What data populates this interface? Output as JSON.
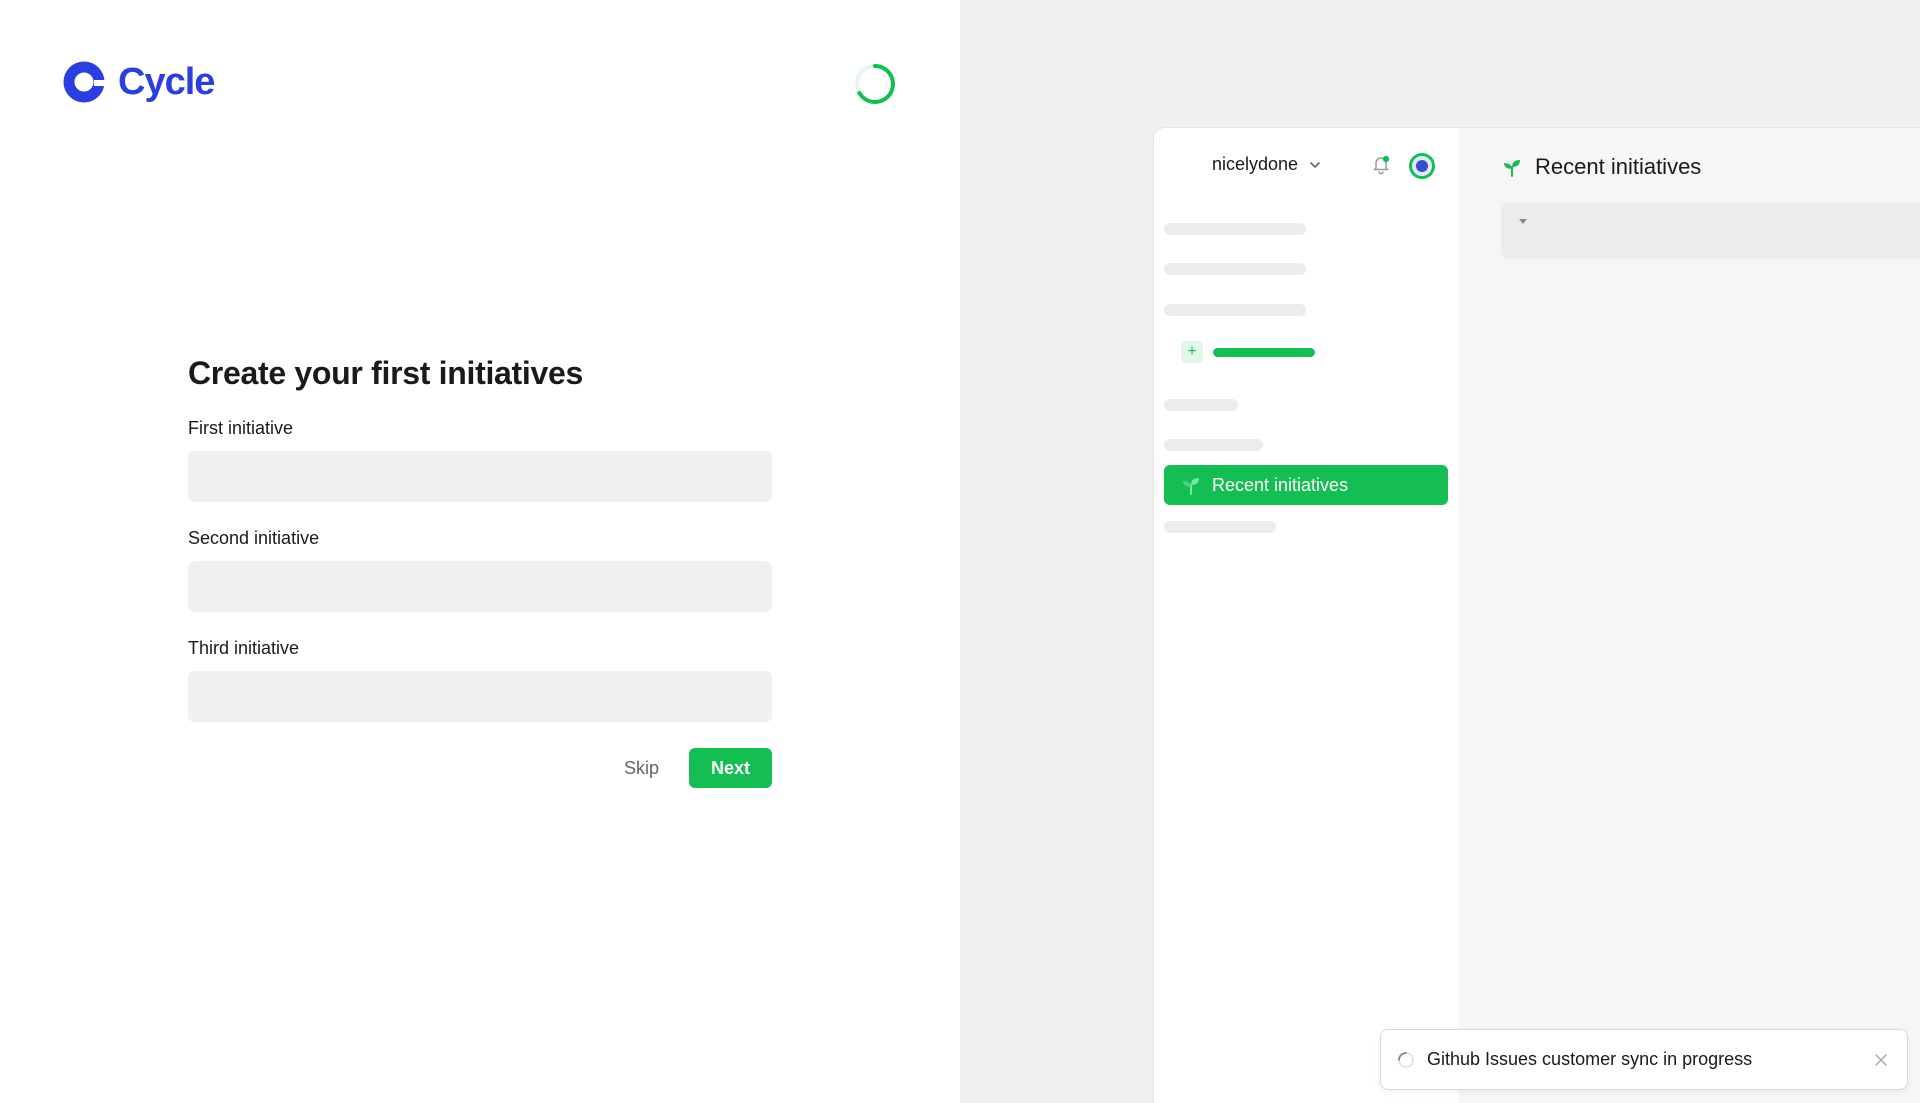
{
  "brand": {
    "name": "Cycle",
    "color": "#2b3fe0"
  },
  "accent_color": "#15be53",
  "form": {
    "title": "Create your first initiatives",
    "fields": [
      {
        "label": "First initiative",
        "value": ""
      },
      {
        "label": "Second initiative",
        "value": ""
      },
      {
        "label": "Third initiative",
        "value": ""
      }
    ],
    "skip_label": "Skip",
    "next_label": "Next"
  },
  "preview": {
    "workspace_name": "nicelydone",
    "active_item_label": "Recent initiatives",
    "main_title": "Recent initiatives"
  },
  "toast": {
    "message": "Github Issues customer sync in progress"
  }
}
